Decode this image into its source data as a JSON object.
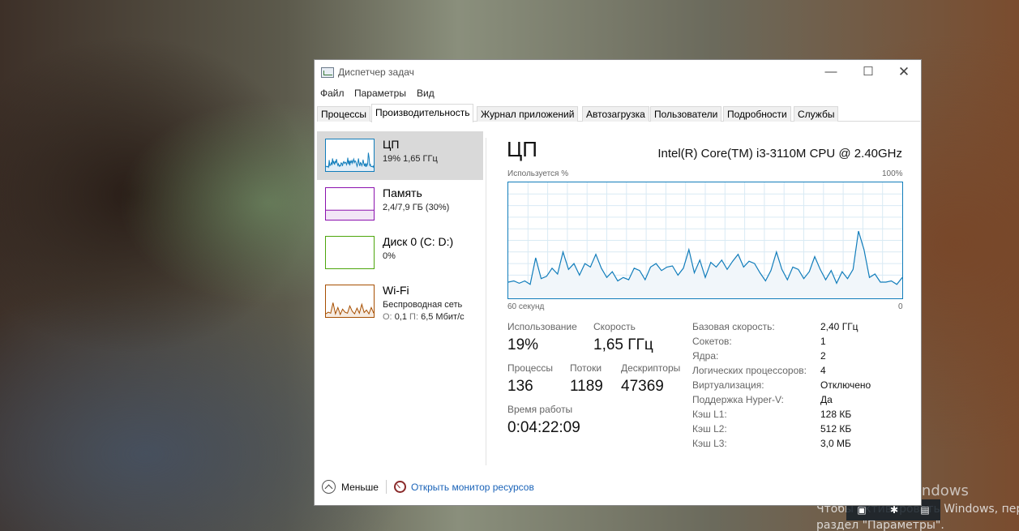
{
  "window": {
    "title": "Диспетчер задач",
    "controls": {
      "minimize": "—",
      "maximize": "☐",
      "close": "✕"
    }
  },
  "menu": [
    "Файл",
    "Параметры",
    "Вид"
  ],
  "tabs": [
    "Процессы",
    "Производительность",
    "Журнал приложений",
    "Автозагрузка",
    "Пользователи",
    "Подробности",
    "Службы"
  ],
  "active_tab": "Производительность",
  "sidebar": {
    "items": [
      {
        "title": "ЦП",
        "sub": "19% 1,65 ГГц",
        "color": "#117dbb"
      },
      {
        "title": "Память",
        "sub": "2,4/7,9 ГБ (30%)",
        "color": "#8b12ae"
      },
      {
        "title": "Диск 0 (C: D:)",
        "sub": "0%",
        "color": "#4da60c"
      },
      {
        "title": "Wi-Fi",
        "sub": "Беспроводная сеть",
        "sub2_send_label": "О:",
        "sub2_send": "0,1",
        "sub2_recv_label": "П:",
        "sub2_recv": "6,5 Мбит/с",
        "color": "#a74f01"
      }
    ]
  },
  "main": {
    "title": "ЦП",
    "cpu_name": "Intel(R) Core(TM) i3-3110M CPU @ 2.40GHz",
    "graph": {
      "y_label": "Используется %",
      "y_max_label": "100%",
      "x_left_label": "60 секунд",
      "x_right_label": "0",
      "line_color": "#117dbb",
      "fill_color": "#f1f6fa",
      "grid_color": "#d9eaf4",
      "usage_values": [
        14,
        15,
        13,
        15,
        12,
        35,
        17,
        19,
        26,
        21,
        40,
        25,
        30,
        20,
        30,
        27,
        38,
        26,
        18,
        23,
        15,
        18,
        16,
        26,
        24,
        16,
        27,
        30,
        24,
        27,
        28,
        20,
        26,
        42,
        22,
        33,
        18,
        31,
        27,
        33,
        25,
        32,
        38,
        27,
        32,
        30,
        22,
        15,
        24,
        40,
        25,
        16,
        27,
        25,
        17,
        23,
        36,
        25,
        16,
        24,
        13,
        23,
        17,
        25,
        58,
        42,
        18,
        21,
        14,
        14,
        15,
        12,
        18
      ]
    },
    "stats": {
      "usage_label": "Использование",
      "usage_value": "19%",
      "speed_label": "Скорость",
      "speed_value": "1,65 ГГц",
      "processes_label": "Процессы",
      "processes_value": "136",
      "threads_label": "Потоки",
      "threads_value": "1189",
      "handles_label": "Дескрипторы",
      "handles_value": "47369",
      "uptime_label": "Время работы",
      "uptime_value": "0:04:22:09"
    },
    "specs": [
      {
        "label": "Базовая скорость:",
        "value": "2,40 ГГц"
      },
      {
        "label": "Сокетов:",
        "value": "1"
      },
      {
        "label": "Ядра:",
        "value": "2"
      },
      {
        "label": "Логических процессоров:",
        "value": "4"
      },
      {
        "label": "Виртуализация:",
        "value": "Отключено"
      },
      {
        "label": "Поддержка Hyper-V:",
        "value": "Да"
      },
      {
        "label": "Кэш L1:",
        "value": "128 КБ"
      },
      {
        "label": "Кэш L2:",
        "value": "512 КБ"
      },
      {
        "label": "Кэш L3:",
        "value": "3,0 МБ"
      }
    ]
  },
  "footer": {
    "fewer_label": "Меньше",
    "monitor_link": "Открыть монитор ресурсов"
  },
  "watermark": {
    "title": "Активация Windows",
    "line1": "Чтобы активировать Windows, пере",
    "line2": "раздел \"Параметры\"."
  }
}
